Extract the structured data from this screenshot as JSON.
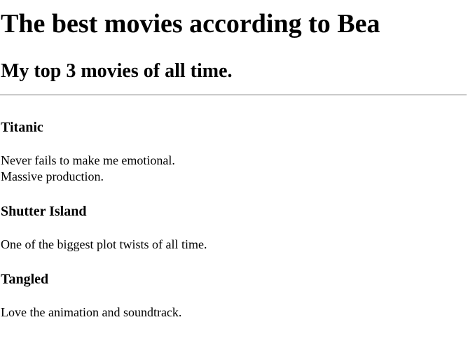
{
  "page": {
    "heading": "The best movies according to Bea",
    "subheading": "My top 3 movies of all time."
  },
  "movies": [
    {
      "title": "Titanic",
      "lines": [
        "Never fails to make me emotional.",
        "Massive production."
      ]
    },
    {
      "title": "Shutter Island",
      "lines": [
        "One of the biggest plot twists of all time."
      ]
    },
    {
      "title": "Tangled",
      "lines": [
        "Love the animation and soundtrack."
      ]
    }
  ]
}
